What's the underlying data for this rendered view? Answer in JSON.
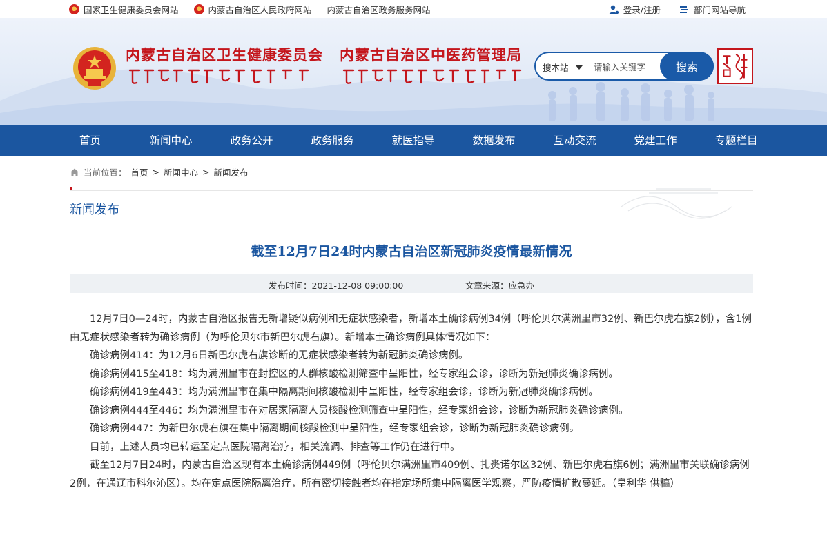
{
  "top_links": {
    "left": [
      "国家卫生健康委员会网站",
      "内蒙古自治区人民政府网站",
      "内蒙古自治区政务服务网站"
    ],
    "login": "登录/注册",
    "dept_nav": "部门网站导航"
  },
  "header": {
    "org1": "内蒙古自治区卫生健康委员会",
    "org2": "内蒙古自治区中医药管理局",
    "search_scope": "搜本站",
    "search_placeholder": "请输入关键字",
    "search_button": "搜索"
  },
  "nav": [
    "首页",
    "新闻中心",
    "政务公开",
    "政务服务",
    "就医指导",
    "数据发布",
    "互动交流",
    "党建工作",
    "专题栏目"
  ],
  "breadcrumb": {
    "label": "当前位置：",
    "items": [
      "首页",
      "新闻中心",
      "新闻发布"
    ],
    "sep": ">"
  },
  "section_title": "新闻发布",
  "article": {
    "title": "截至12月7日24时内蒙古自治区新冠肺炎疫情最新情况",
    "publish_label": "发布时间：",
    "publish_time": "2021-12-08 09:00:00",
    "source_label": "文章来源：",
    "source": "应急办",
    "paragraphs": [
      "12月7日0—24时，内蒙古自治区报告无新增疑似病例和无症状感染者，新增本土确诊病例34例（呼伦贝尔满洲里市32例、新巴尔虎右旗2例），含1例由无症状感染者转为确诊病例（为呼伦贝尔市新巴尔虎右旗）。新增本土确诊病例具体情况如下：",
      "确诊病例414：为12月6日新巴尔虎右旗诊断的无症状感染者转为新冠肺炎确诊病例。",
      "确诊病例415至418：均为满洲里市在封控区的人群核酸检测筛查中呈阳性，经专家组会诊，诊断为新冠肺炎确诊病例。",
      "确诊病例419至443：均为满洲里市在集中隔离期间核酸检测中呈阳性，经专家组会诊，诊断为新冠肺炎确诊病例。",
      "确诊病例444至446：均为满洲里市在对居家隔离人员核酸检测筛查中呈阳性，经专家组会诊，诊断为新冠肺炎确诊病例。",
      "确诊病例447：为新巴尔虎右旗在集中隔离期间核酸检测中呈阳性，经专家组会诊，诊断为新冠肺炎确诊病例。",
      "目前，上述人员均已转运至定点医院隔离治疗，相关流调、排查等工作仍在进行中。",
      "截至12月7日24时，内蒙古自治区现有本土确诊病例449例（呼伦贝尔满洲里市409例、扎赉诺尔区32例、新巴尔虎右旗6例；满洲里市关联确诊病例2例，在通辽市科尔沁区）。均在定点医院隔离治疗，所有密切接触者均在指定场所集中隔离医学观察，严防疫情扩散蔓延。（皇利华 供稿）"
    ]
  },
  "colors": {
    "primary_blue": "#1b56a0",
    "title_red": "#c4161c"
  }
}
